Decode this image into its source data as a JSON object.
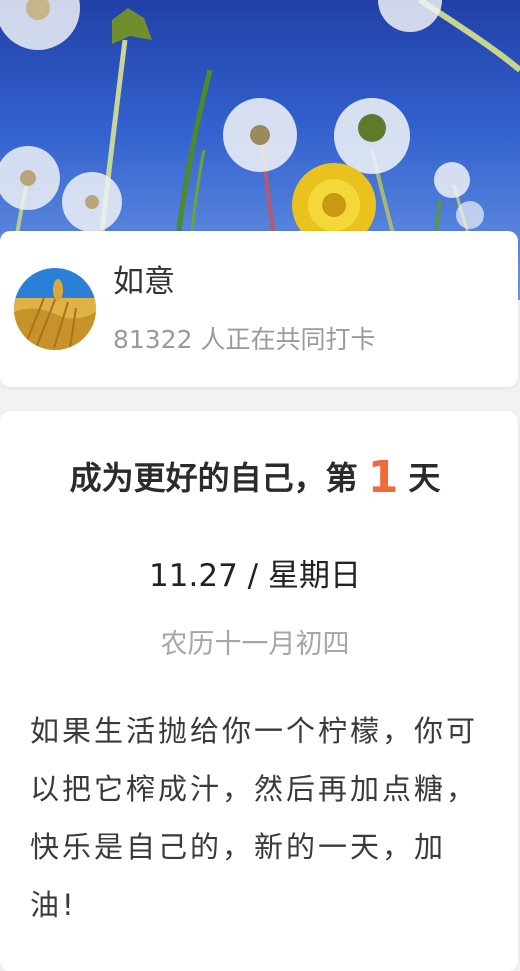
{
  "header": {
    "image": "dandelions-blue-sky"
  },
  "group": {
    "avatar": "wheat-field",
    "name": "如意",
    "participants_text": "81322 人正在共同打卡"
  },
  "checkin": {
    "headline_prefix": "成为更好的自己，第",
    "day_number": "1",
    "headline_suffix": "天",
    "date": "11.27 / 星期日",
    "lunar_date": "农历十一月初四",
    "quote": "如果生活抛给你一个柠檬，你可以把它榨成汁，然后再加点糖，快乐是自己的，新的一天，加油!"
  },
  "colors": {
    "accent": "#f2693a",
    "sky": "#3463cf"
  }
}
